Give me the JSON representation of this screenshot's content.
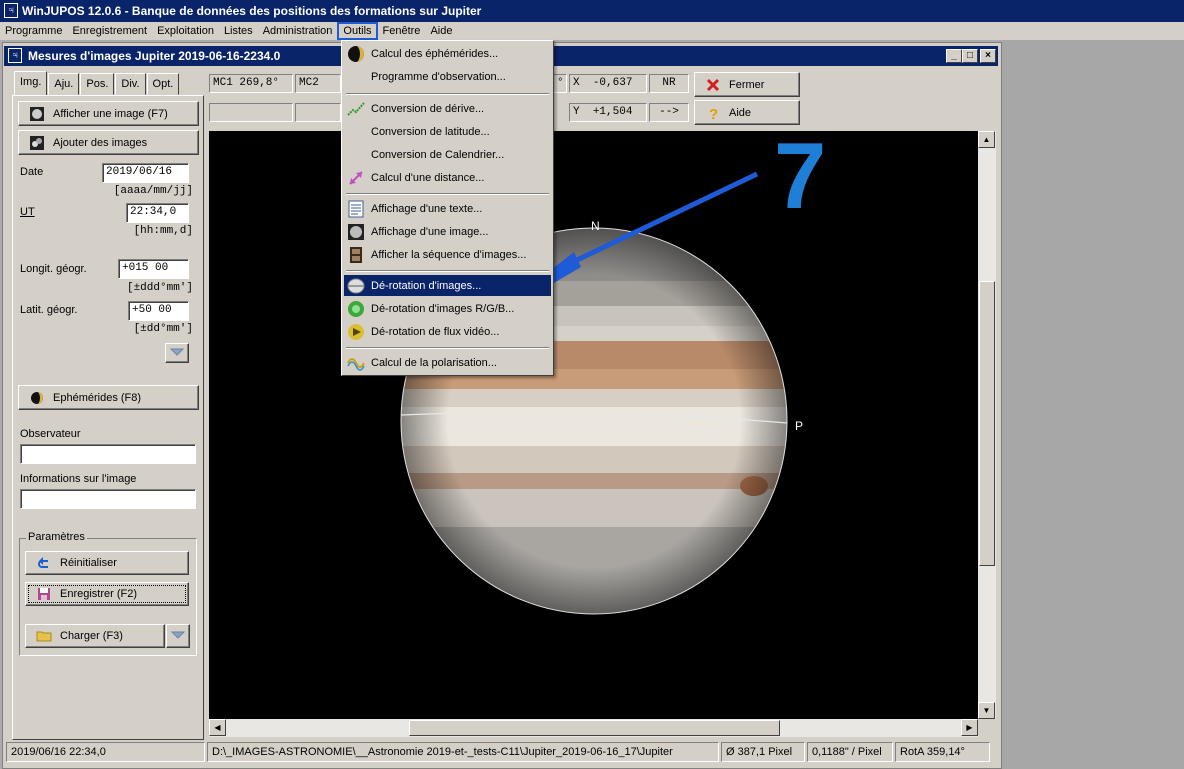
{
  "app": {
    "title": "WinJUPOS 12.0.6 - Banque de données des positions des formations sur Jupiter"
  },
  "menubar": [
    {
      "label": "Programme"
    },
    {
      "label": "Enregistrement"
    },
    {
      "label": "Exploitation"
    },
    {
      "label": "Listes"
    },
    {
      "label": "Administration"
    },
    {
      "label": "Outils"
    },
    {
      "label": "Fenêtre"
    },
    {
      "label": "Aide"
    }
  ],
  "child_window": {
    "title": "Mesures d'images Jupiter  2019-06-16-2234.0",
    "min": "_",
    "max": "□",
    "close": "×"
  },
  "tabs": [
    {
      "label": "Img."
    },
    {
      "label": "Aju."
    },
    {
      "label": "Pos."
    },
    {
      "label": "Div."
    },
    {
      "label": "Opt."
    }
  ],
  "left": {
    "show_image": "Afficher une image (F7)",
    "add_images": "Ajouter des images",
    "date_label": "Date",
    "date_value": "2019/06/16",
    "date_hint": "[aaaa/mm/jj]",
    "ut_label": "UT",
    "ut_value": "22:34,0",
    "ut_hint": "[hh:mm,d]",
    "long_label": "Longit. géogr.",
    "long_value": "+015 00",
    "long_hint": "[±ddd°mm']",
    "lat_label": "Latit. géogr.",
    "lat_value": "+50 00",
    "lat_hint": "[±dd°mm']",
    "ephem": "Ephémérides (F8)",
    "observer_label": "Observateur",
    "observer_value": "",
    "imginfo_label": "Informations sur l'image",
    "imginfo_value": "",
    "params_label": "Paramètres",
    "reset": "Réinitialiser",
    "save": "Enregistrer (F2)",
    "load": "Charger (F3)"
  },
  "top": {
    "mc1": "MC1 269,8°",
    "mc2": "MC2",
    "deg": "°",
    "x_label": "X",
    "x_value": "-0,637",
    "nr": "NR",
    "y_label": "Y",
    "y_value": "+1,504",
    "arrow": "-->",
    "close": "Fermer",
    "help": "Aide"
  },
  "image": {
    "n_label": "N",
    "p_label": "P",
    "step_number": "7"
  },
  "menu_outils": [
    {
      "label": "Calcul des éphémérides...",
      "icon": "ephemeris-icon"
    },
    {
      "label": "Programme d'observation...",
      "icon": ""
    },
    {
      "sep": true
    },
    {
      "label": "Conversion de dérive...",
      "icon": "drift-icon"
    },
    {
      "label": "Conversion de latitude...",
      "icon": ""
    },
    {
      "label": "Conversion de Calendrier...",
      "icon": ""
    },
    {
      "label": "Calcul d'une distance...",
      "icon": "distance-icon"
    },
    {
      "sep": true
    },
    {
      "label": "Affichage d'une texte...",
      "icon": "text-icon"
    },
    {
      "label": "Affichage d'une image...",
      "icon": "image-icon"
    },
    {
      "label": "Afficher la séquence d'images...",
      "icon": "film-icon"
    },
    {
      "sep": true
    },
    {
      "label": "Dé-rotation d'images...",
      "icon": "derotation-icon",
      "highlighted": true
    },
    {
      "label": "Dé-rotation d'images R/G/B...",
      "icon": "rgb-derotation-icon"
    },
    {
      "label": "Dé-rotation de flux vidéo...",
      "icon": "video-derotation-icon"
    },
    {
      "sep": true
    },
    {
      "label": "Calcul de la polarisation...",
      "icon": "polarisation-icon"
    }
  ],
  "status": {
    "datetime": "2019/06/16   22:34,0",
    "path": "D:\\_IMAGES-ASTRONOMIE\\__Astronomie 2019-et-_tests-C11\\Jupiter_2019-06-16_17\\Jupiter",
    "diameter": "Ø 387,1 Pixel",
    "scale": "0,1188\" / Pixel",
    "rota": "RotA 359,14°"
  },
  "colors": {
    "titlebar": "#0a246a",
    "face": "#d4d0c8",
    "annotation_arrow": "#1f5bd6"
  }
}
